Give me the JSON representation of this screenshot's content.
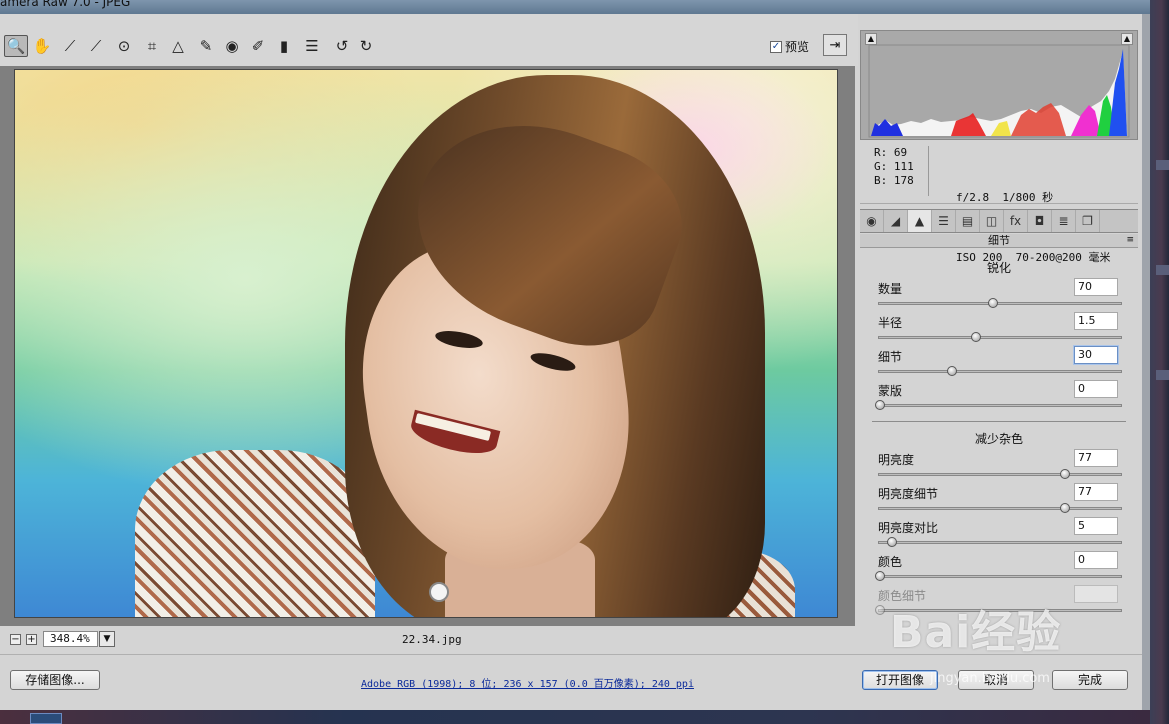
{
  "window": {
    "title": "amera Raw 7.0 - JPEG"
  },
  "toolbar": {
    "tools": [
      {
        "name": "zoom-tool-icon",
        "glyph": "🔍"
      },
      {
        "name": "hand-tool-icon",
        "glyph": "✋"
      },
      {
        "name": "white-balance-tool-icon",
        "glyph": "⟋"
      },
      {
        "name": "color-sampler-tool-icon",
        "glyph": "⟋"
      },
      {
        "name": "targeted-adjustment-tool-icon",
        "glyph": "⊙"
      },
      {
        "name": "crop-tool-icon",
        "glyph": "⌗"
      },
      {
        "name": "straighten-tool-icon",
        "glyph": "△"
      },
      {
        "name": "spot-removal-tool-icon",
        "glyph": "✎"
      },
      {
        "name": "red-eye-tool-icon",
        "glyph": "◉"
      },
      {
        "name": "adjustment-brush-icon",
        "glyph": "✐"
      },
      {
        "name": "graduated-filter-icon",
        "glyph": "▮"
      },
      {
        "name": "preferences-icon",
        "glyph": "☰"
      },
      {
        "name": "rotate-left-icon",
        "glyph": "↺"
      },
      {
        "name": "rotate-right-icon",
        "glyph": "↻"
      }
    ],
    "preview_label": "预览",
    "preview_checked": "✓",
    "fullscreen_glyph": "⇥"
  },
  "canvas": {
    "zoom_value": "348.4%",
    "zoom_minus": "−",
    "zoom_plus": "+",
    "zoom_drop": "▼",
    "filename": "22.34.jpg"
  },
  "info": {
    "r": "R:  69",
    "g": "G:  111",
    "b": "B:  178",
    "aperture_shutter": "f/2.8  1/800 秒",
    "iso_lens": "ISO 200  70-200@200 毫米"
  },
  "histogram": {
    "clip_shadow": "▲",
    "clip_highlight": "▲"
  },
  "panel": {
    "tabs": [
      {
        "name": "basic-tab-icon",
        "glyph": "◉"
      },
      {
        "name": "tone-curve-tab-icon",
        "glyph": "◢"
      },
      {
        "name": "detail-tab-icon",
        "glyph": "▲"
      },
      {
        "name": "hsl-tab-icon",
        "glyph": "☰"
      },
      {
        "name": "split-toning-tab-icon",
        "glyph": "▤"
      },
      {
        "name": "lens-corrections-tab-icon",
        "glyph": "◫"
      },
      {
        "name": "effects-tab-icon",
        "glyph": "fx"
      },
      {
        "name": "camera-calibration-tab-icon",
        "glyph": "◘"
      },
      {
        "name": "presets-tab-icon",
        "glyph": "≣"
      },
      {
        "name": "snapshots-tab-icon",
        "glyph": "❐"
      }
    ],
    "section_title": "细节",
    "section_menu": "≡",
    "sharpening": {
      "title": "锐化",
      "sliders": [
        {
          "label": "数量",
          "value": "70",
          "level": 0.47
        },
        {
          "label": "半径",
          "value": "1.5",
          "level": 0.4
        },
        {
          "label": "细节",
          "value": "30",
          "level": 0.3
        },
        {
          "label": "蒙版",
          "value": "0",
          "level": 0.0
        }
      ]
    },
    "noise": {
      "title": "减少杂色",
      "sliders": [
        {
          "label": "明亮度",
          "value": "77",
          "level": 0.77
        },
        {
          "label": "明亮度细节",
          "value": "77",
          "level": 0.77
        },
        {
          "label": "明亮度对比",
          "value": "5",
          "level": 0.05
        },
        {
          "label": "颜色",
          "value": "0",
          "level": 0.0
        },
        {
          "label": "颜色细节",
          "value": "",
          "level": 0.0
        }
      ]
    }
  },
  "footer": {
    "save_label": "存储图像...",
    "workflow_text": "Adobe RGB (1998); 8 位; 236 x 157 (0.0 百万像素); 240 ppi",
    "open_label": "打开图像",
    "cancel_label": "取消",
    "done_label": "完成"
  },
  "watermark": {
    "brand": "Bai经验",
    "url": "jingyan.baidu.com"
  }
}
